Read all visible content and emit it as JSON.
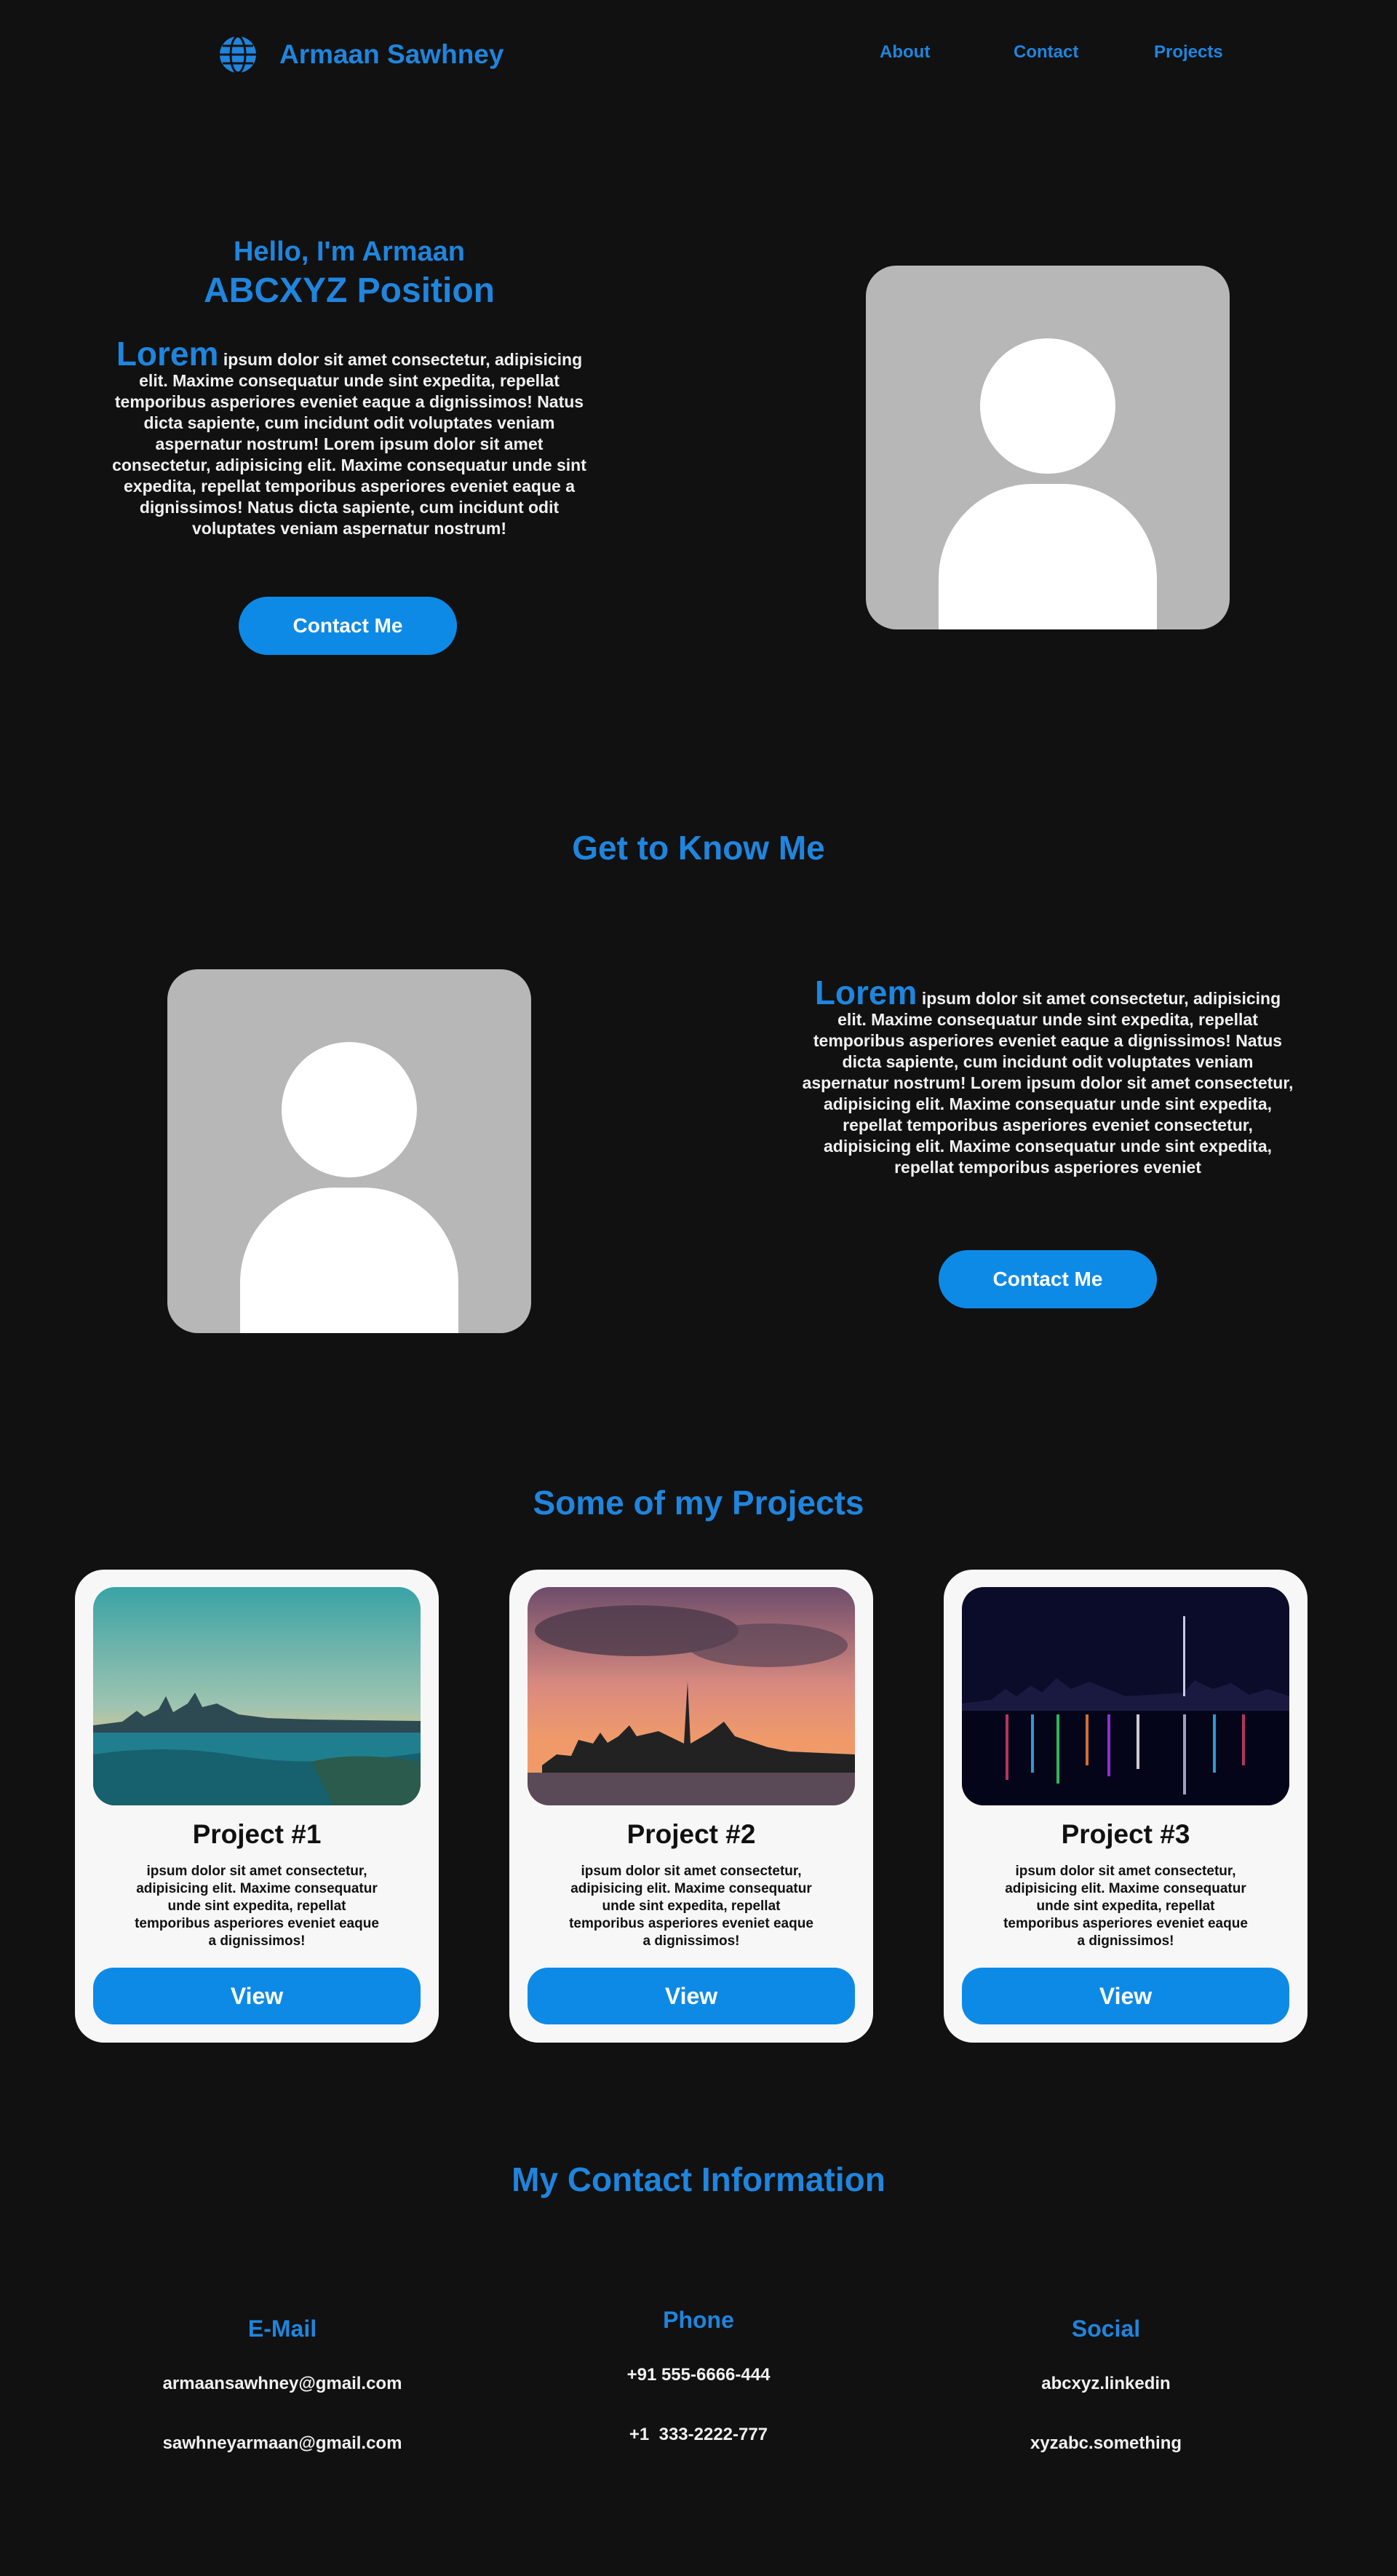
{
  "nav": {
    "brand": "Armaan Sawhney",
    "links": [
      "About",
      "Contact",
      "Projects"
    ]
  },
  "hero": {
    "greeting": "Hello, I'm Armaan",
    "position": "ABCXYZ Position",
    "lead_word": "Lorem",
    "body": "ipsum dolor sit amet consectetur, adipisicing elit. Maxime consequatur unde sint expedita, repellat temporibus asperiores eveniet eaque a dignissimos! Natus dicta sapiente, cum incidunt odit voluptates veniam aspernatur nostrum! Lorem ipsum dolor sit amet consectetur, adipisicing elit. Maxime consequatur unde sint expedita, repellat temporibus asperiores eveniet eaque a dignissimos! Natus dicta sapiente, cum incidunt odit voluptates veniam aspernatur nostrum!",
    "button": "Contact Me"
  },
  "about": {
    "title": "Get to Know Me",
    "lead_word": "Lorem",
    "body": "ipsum dolor sit amet consectetur, adipisicing elit. Maxime consequatur unde sint expedita, repellat temporibus asperiores eveniet eaque a dignissimos! Natus dicta sapiente, cum incidunt odit voluptates veniam aspernatur nostrum! Lorem ipsum dolor sit amet consectetur, adipisicing elit. Maxime consequatur unde sint expedita, repellat temporibus asperiores eveniet consectetur, adipisicing elit. Maxime consequatur unde sint expedita, repellat temporibus asperiores eveniet",
    "button": "Contact Me"
  },
  "projects": {
    "title": "Some of my Projects",
    "items": [
      {
        "title": "Project #1",
        "desc": "ipsum dolor sit amet consectetur, adipisicing elit. Maxime consequatur unde sint expedita, repellat temporibus asperiores eveniet eaque a dignissimos!",
        "button": "View"
      },
      {
        "title": "Project #2",
        "desc": "ipsum dolor sit amet consectetur, adipisicing elit. Maxime consequatur unde sint expedita, repellat temporibus asperiores eveniet eaque a dignissimos!",
        "button": "View"
      },
      {
        "title": "Project #3",
        "desc": "ipsum dolor sit amet consectetur, adipisicing elit. Maxime consequatur unde sint expedita, repellat temporibus asperiores eveniet eaque a dignissimos!",
        "button": "View"
      }
    ]
  },
  "contact": {
    "title": "My Contact Information",
    "email": {
      "heading": "E-Mail",
      "values": [
        "armaansawhney@gmail.com",
        "sawhneyarmaan@gmail.com"
      ]
    },
    "phone": {
      "heading": "Phone",
      "values": [
        "+91 555-6666-444",
        "+1  333-2222-777"
      ]
    },
    "social": {
      "heading": "Social",
      "values": [
        "abcxyz.linkedin",
        "xyzabc.something"
      ]
    }
  },
  "colors": {
    "background": "#111111",
    "accent": "#1f85de",
    "button": "#0d8ae6",
    "card": "#f7f7f7",
    "avatar_bg": "#b7b7b7"
  },
  "icons": {
    "logo": "globe-icon",
    "avatar": "user-silhouette-icon"
  }
}
